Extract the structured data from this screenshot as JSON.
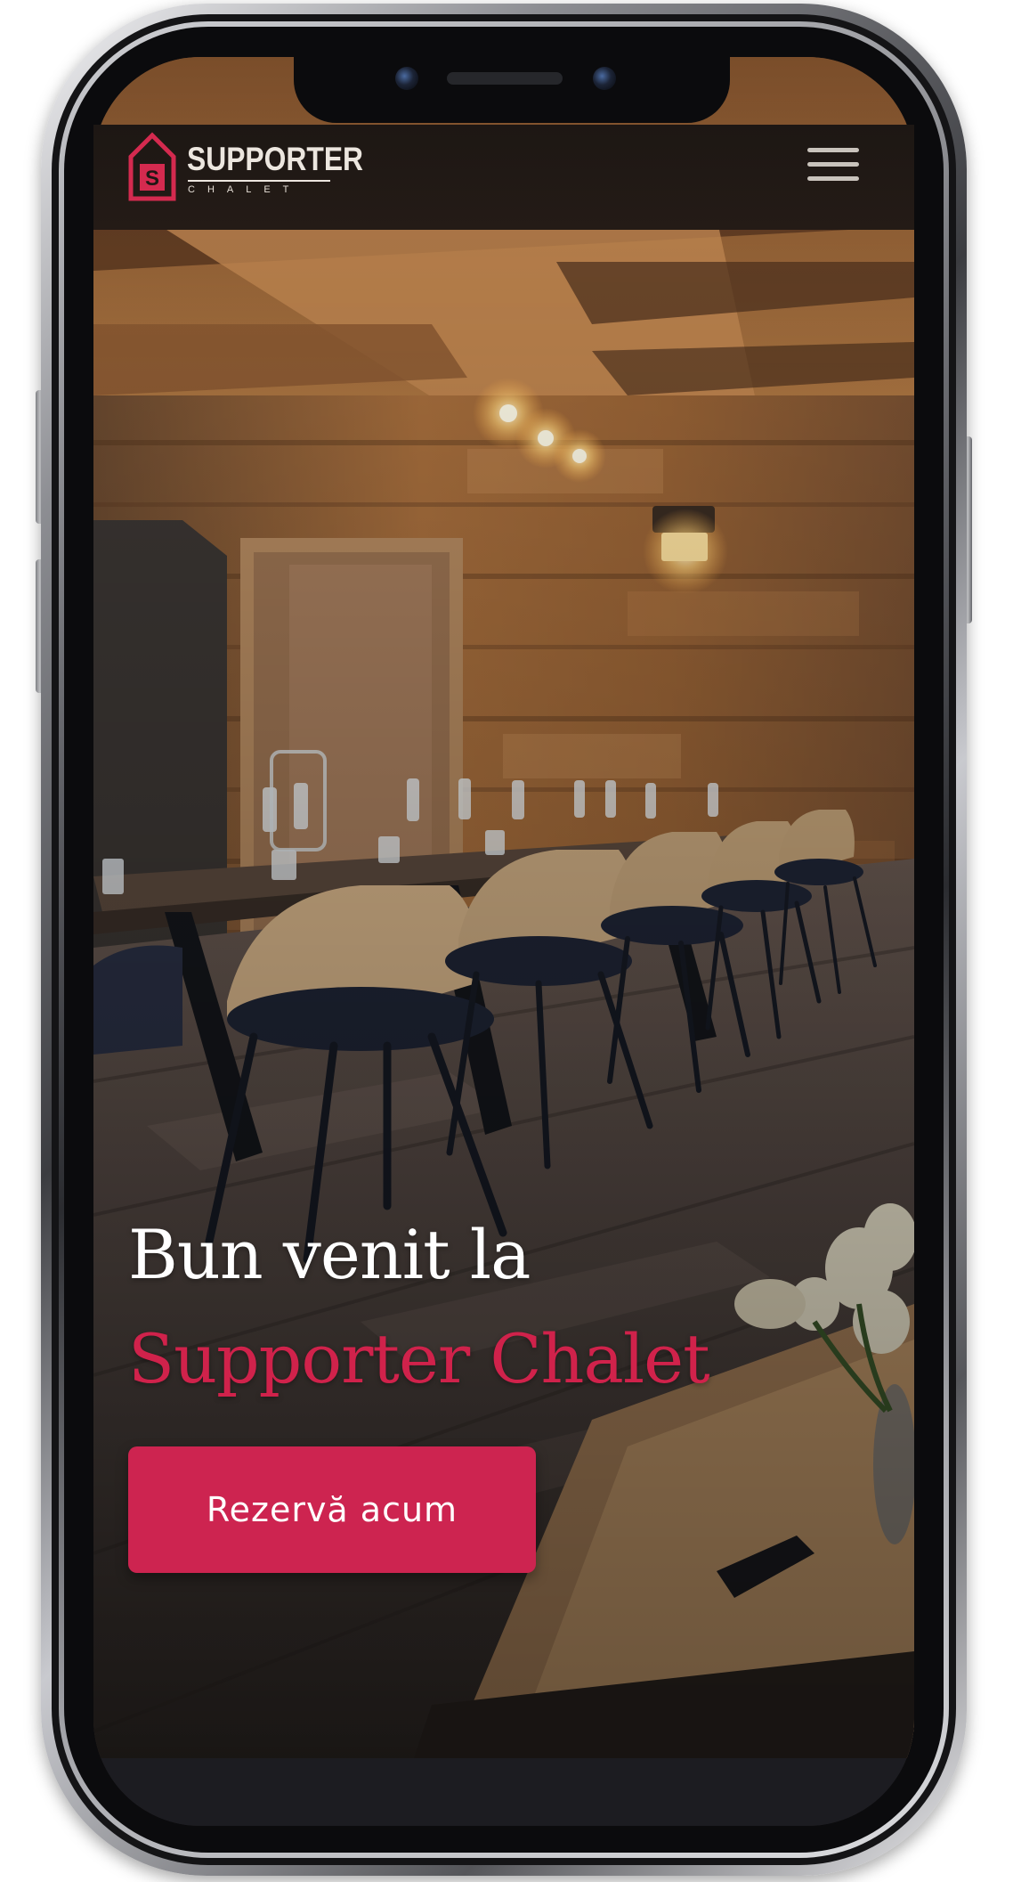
{
  "brand": {
    "name": "SUPPORTER",
    "subname": "CHALET",
    "logo_letter": "S",
    "accent_color": "#cd2450"
  },
  "header": {
    "menu_icon": "hamburger-menu-icon"
  },
  "hero": {
    "line1": "Bun venit la",
    "line2": "Supporter Chalet",
    "cta_label": "Rezervă acum",
    "background": "photo-dining-room-wooden-chalet"
  },
  "device": {
    "type": "smartphone-frame"
  }
}
